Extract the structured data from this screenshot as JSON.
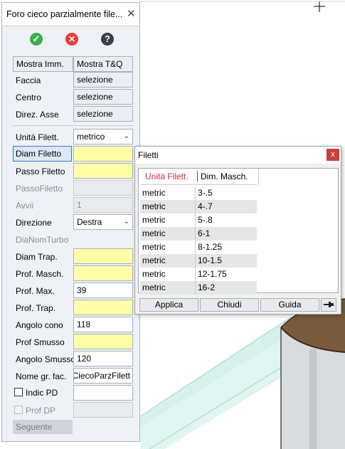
{
  "panel": {
    "title": "Foro cieco parzialmente file...",
    "close_glyph": "✕",
    "icons": [
      "check-icon",
      "cancel-icon",
      "help-icon"
    ],
    "tabs": {
      "mostra_imm": "Mostra Imm.",
      "mostra_tq": "Mostra T&Q"
    },
    "rows": {
      "faccia": {
        "label": "Faccia",
        "value": "selezione"
      },
      "centro": {
        "label": "Centro",
        "value": "selezione"
      },
      "direz_asse": {
        "label": "Direz. Asse",
        "value": "selezione"
      },
      "unita_filett": {
        "label": "Unità Filett.",
        "value": "metrico"
      },
      "diam_filetto": {
        "label": "Diam Filetto",
        "value": ""
      },
      "passo_filetto": {
        "label": "Passo Filetto",
        "value": ""
      },
      "passofiletto": {
        "label": "PassoFiletto",
        "value": ""
      },
      "avvii": {
        "label": "Avvii",
        "value": "1"
      },
      "direzione": {
        "label": "Direzione",
        "value": "Destra"
      },
      "dianomturbo": {
        "label": "DiaNomTurbo",
        "value": ""
      },
      "diam_trap": {
        "label": "Diam Trap.",
        "value": ""
      },
      "prof_masch": {
        "label": "Prof. Masch.",
        "value": ""
      },
      "prof_max": {
        "label": "Prof. Max.",
        "value": "39"
      },
      "prof_trap": {
        "label": "Prof. Trap.",
        "value": ""
      },
      "angolo_cono": {
        "label": "Angolo cono",
        "value": "118"
      },
      "prof_smusso": {
        "label": "Prof Smusso",
        "value": ""
      },
      "angolo_smusso": {
        "label": "Angolo Smusso",
        "value": "120"
      },
      "nome_gr_fac": {
        "label": "Nome gr. fac.",
        "value": "CiecoParzFilett"
      },
      "indic_pd": {
        "label": "Indic PD",
        "value": "",
        "checked": false
      },
      "prof_dp": {
        "label": "Prof DP",
        "value": "",
        "checked": false
      }
    },
    "seguente": "Seguente"
  },
  "dialog": {
    "title": "Filetti",
    "close_glyph": "x",
    "headers": {
      "unita": "Unità Filett.",
      "dim": "Dim. Masch."
    },
    "rows": [
      {
        "unit": "metric",
        "dim": "3-.5"
      },
      {
        "unit": "metric",
        "dim": "4-.7"
      },
      {
        "unit": "metric",
        "dim": "5-.8"
      },
      {
        "unit": "metric",
        "dim": "6-1"
      },
      {
        "unit": "metric",
        "dim": "8-1.25"
      },
      {
        "unit": "metric",
        "dim": "10-1.5"
      },
      {
        "unit": "metric",
        "dim": "12-1.75"
      },
      {
        "unit": "metric",
        "dim": "16-2"
      }
    ],
    "buttons": {
      "applica": "Applica",
      "chiudi": "Chiudi",
      "guida": "Guida",
      "pin_icon": "pin-icon"
    }
  },
  "colors": {
    "required_field": "#ffffa8",
    "header_accent": "#c0303a",
    "ok_green": "#3cb04a",
    "cancel_red": "#e0433b",
    "help_dark": "#3a3f45",
    "model_brown": "#7a5a3c",
    "model_glass": "#c8ece4"
  }
}
